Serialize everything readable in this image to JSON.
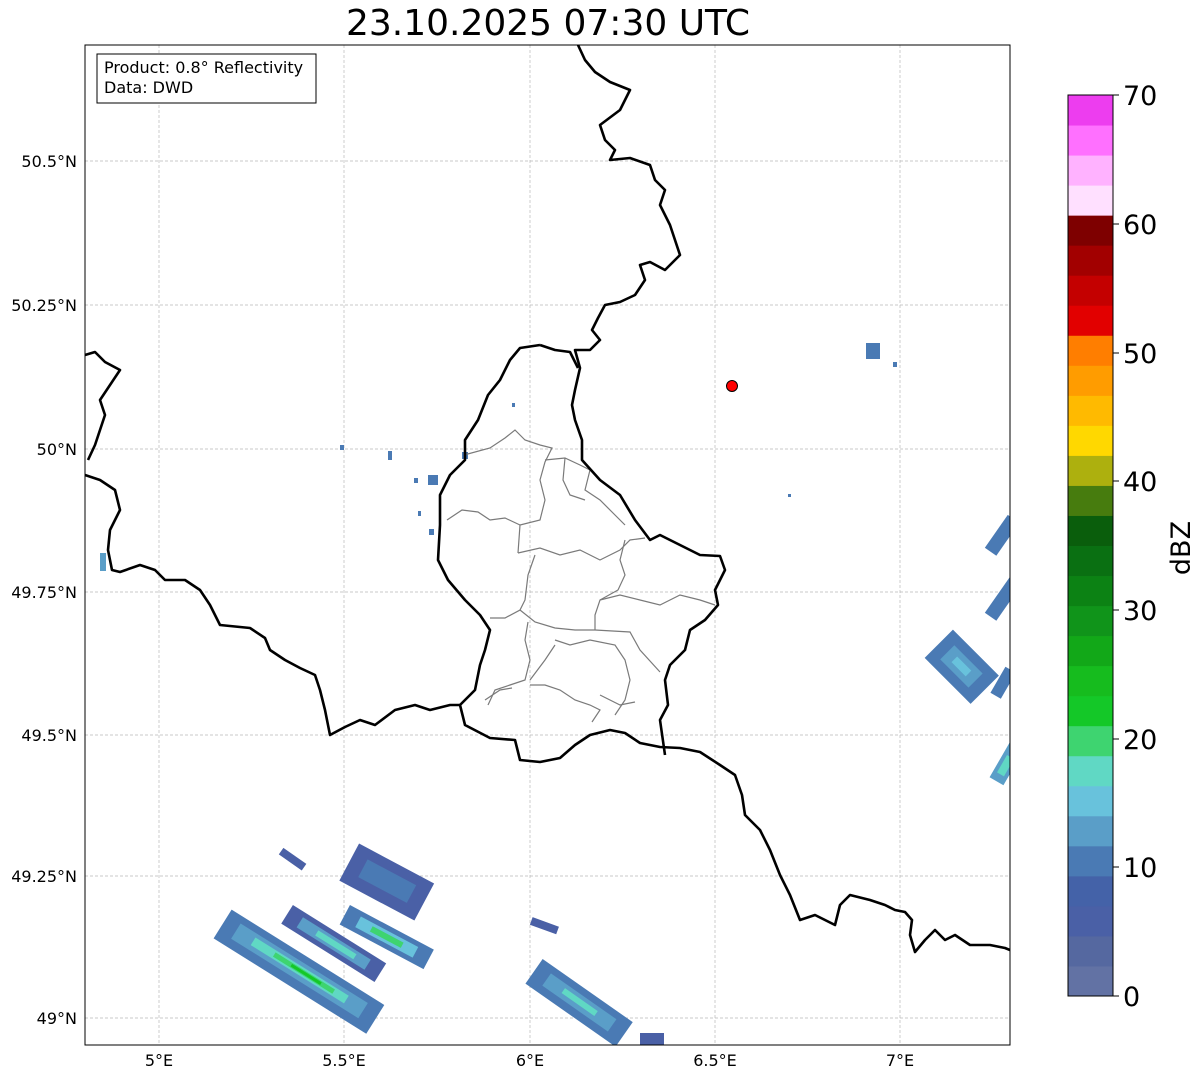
{
  "title": "23.10.2025 07:30 UTC",
  "info_box": {
    "product": "Product: 0.8° Reflectivity",
    "data": "Data: DWD"
  },
  "axes": {
    "lon_ticks": [
      "5°E",
      "5.5°E",
      "6°E",
      "6.5°E",
      "7°E"
    ],
    "lat_ticks": [
      "50.5°N",
      "50.25°N",
      "50°N",
      "49.75°N",
      "49.5°N",
      "49.25°N",
      "49°N"
    ]
  },
  "colorbar": {
    "label": "dBZ",
    "tick_labels": [
      "0",
      "10",
      "20",
      "30",
      "40",
      "50",
      "60",
      "70"
    ],
    "colors": [
      "#6272a4",
      "#5568a0",
      "#4a60a6",
      "#4462a8",
      "#4a7ab4",
      "#5a9ec8",
      "#68c2dc",
      "#60d8c4",
      "#3ed470",
      "#14c828",
      "#16bc1e",
      "#12a818",
      "#10941a",
      "#0c8214",
      "#0a7012",
      "#0a5e0c",
      "#477c0e",
      "#adb00e",
      "#ffd800",
      "#ffba00",
      "#ff9c00",
      "#ff7e00",
      "#e20000",
      "#c40000",
      "#a20000",
      "#7e0000",
      "#ffe0ff",
      "#ffb2ff",
      "#ff70ff",
      "#ed3def"
    ]
  },
  "map": {
    "marker": {
      "name": "radar-site",
      "color": "#ff0000"
    },
    "grid": true
  }
}
